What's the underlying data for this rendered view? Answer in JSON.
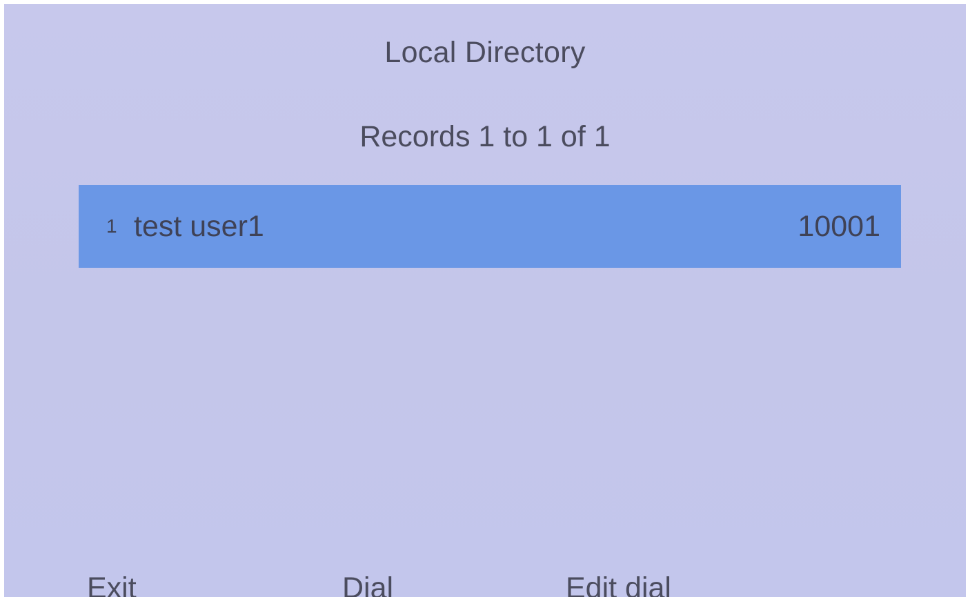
{
  "header": {
    "title": "Local Directory",
    "records_summary": "Records 1 to 1 of 1"
  },
  "directory": {
    "entries": [
      {
        "index": "1",
        "name": "test user1",
        "number": "10001",
        "selected": true
      }
    ]
  },
  "softkeys": {
    "exit": "Exit",
    "dial": "Dial",
    "edit_dial": "Edit dial"
  },
  "colors": {
    "background": "#c5c7eb",
    "selection": "#6a97e6",
    "text": "#4b4c5e"
  }
}
